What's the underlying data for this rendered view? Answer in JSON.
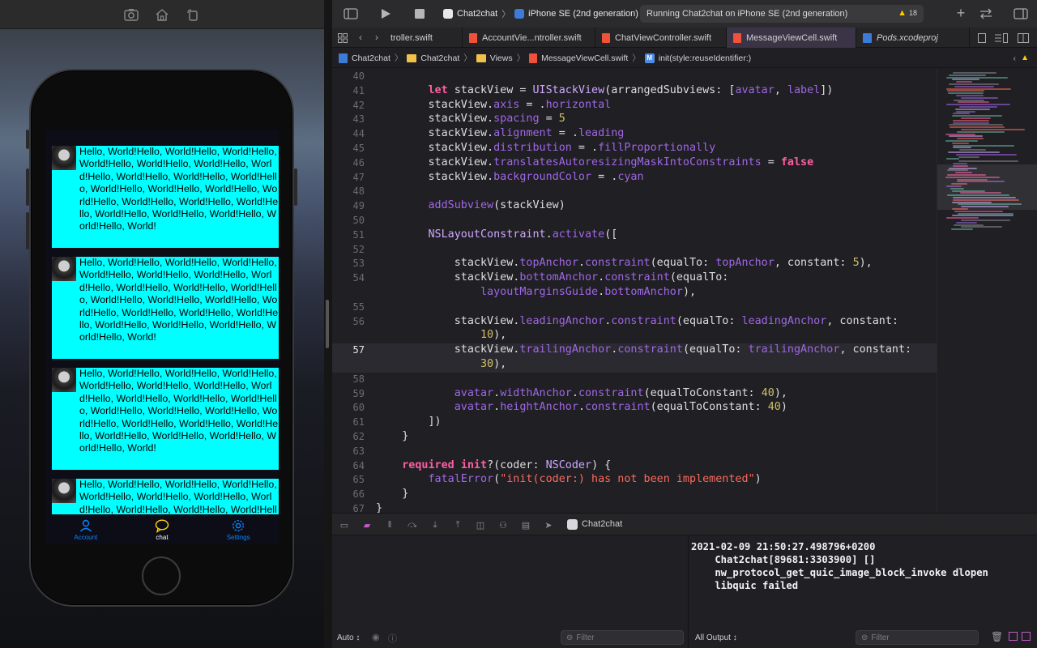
{
  "simulator": {
    "toolbar_icons": [
      "screenshot-icon",
      "home-icon",
      "rotate-icon"
    ],
    "message_text": "Hello, World!Hello, World!Hello, World!Hello, World!Hello, World!Hello, World!Hello, World!Hello, World!Hello, World!Hello, World!Hello, World!Hello, World!Hello, World!Hello, World!Hello, World!Hello, World!Hello, World!Hello, World!Hello, World!Hello, World!Hello, World!Hello, World!",
    "tabs": [
      {
        "label": "Account",
        "icon": "person-icon",
        "color": "#0a84ff"
      },
      {
        "label": "chat",
        "icon": "chat-bubble-icon",
        "color": "#ffd60a"
      },
      {
        "label": "Settings",
        "icon": "gear-icon",
        "color": "#0a84ff"
      }
    ],
    "cell_color": "#00ffff"
  },
  "xcode": {
    "scheme": {
      "app": "Chat2chat",
      "device": "iPhone SE (2nd generation)"
    },
    "run_status": "Running Chat2chat on iPhone SE (2nd generation)",
    "warning_count": "18",
    "tabs": [
      {
        "label": "troller.swift",
        "active": false
      },
      {
        "label": "AccountVie...ntroller.swift",
        "active": false
      },
      {
        "label": "ChatViewController.swift",
        "active": false
      },
      {
        "label": "MessageViewCell.swift",
        "active": true
      },
      {
        "label": "Pods.xcodeproj",
        "active": false
      }
    ],
    "breadcrumb": [
      "Chat2chat",
      "Chat2chat",
      "Views",
      "MessageViewCell.swift",
      "init(style:reuseIdentifier:)"
    ],
    "current_line": 57,
    "code_lines": [
      {
        "n": "40",
        "text": ""
      },
      {
        "n": "41",
        "text": "        let stackView = UIStackView(arrangedSubviews: [avatar, label])"
      },
      {
        "n": "42",
        "text": "        stackView.axis = .horizontal"
      },
      {
        "n": "43",
        "text": "        stackView.spacing = 5"
      },
      {
        "n": "44",
        "text": "        stackView.alignment = .leading"
      },
      {
        "n": "45",
        "text": "        stackView.distribution = .fillProportionally"
      },
      {
        "n": "46",
        "text": "        stackView.translatesAutoresizingMaskIntoConstraints = false"
      },
      {
        "n": "47",
        "text": "        stackView.backgroundColor = .cyan"
      },
      {
        "n": "48",
        "text": ""
      },
      {
        "n": "49",
        "text": "        addSubview(stackView)"
      },
      {
        "n": "50",
        "text": ""
      },
      {
        "n": "51",
        "text": "        NSLayoutConstraint.activate(["
      },
      {
        "n": "52",
        "text": ""
      },
      {
        "n": "53",
        "text": "            stackView.topAnchor.constraint(equalTo: topAnchor, constant: 5),"
      },
      {
        "n": "54",
        "text": "            stackView.bottomAnchor.constraint(equalTo:"
      },
      {
        "n": "",
        "text": "                layoutMarginsGuide.bottomAnchor),"
      },
      {
        "n": "55",
        "text": ""
      },
      {
        "n": "56",
        "text": "            stackView.leadingAnchor.constraint(equalTo: leadingAnchor, constant:"
      },
      {
        "n": "",
        "text": "                10),"
      },
      {
        "n": "57",
        "text": "            stackView.trailingAnchor.constraint(equalTo: trailingAnchor, constant:"
      },
      {
        "n": "",
        "text": "                30),"
      },
      {
        "n": "58",
        "text": ""
      },
      {
        "n": "59",
        "text": "            avatar.widthAnchor.constraint(equalToConstant: 40),"
      },
      {
        "n": "60",
        "text": "            avatar.heightAnchor.constraint(equalToConstant: 40)"
      },
      {
        "n": "61",
        "text": "        ])"
      },
      {
        "n": "62",
        "text": "    }"
      },
      {
        "n": "63",
        "text": ""
      },
      {
        "n": "64",
        "text": "    required init?(coder: NSCoder) {"
      },
      {
        "n": "65",
        "text": "        fatalError(\"init(coder:) has not been implemented\")"
      },
      {
        "n": "66",
        "text": "    }"
      },
      {
        "n": "67",
        "text": "}"
      }
    ],
    "debug_target": "Chat2chat",
    "console_lines": [
      "2021-02-09 21:50:27.498796+0200",
      "    Chat2chat[89681:3303900] []",
      "    nw_protocol_get_quic_image_block_invoke dlopen",
      "    libquic failed"
    ],
    "vars_mode": "Auto ↕",
    "output_mode": "All Output ↕",
    "filter_placeholder": "Filter",
    "colors": {
      "keyword": "#fc5fa3",
      "type": "#d0a8ff",
      "property": "#a167e6",
      "number": "#d0bf69",
      "string": "#fc6a5d"
    }
  }
}
